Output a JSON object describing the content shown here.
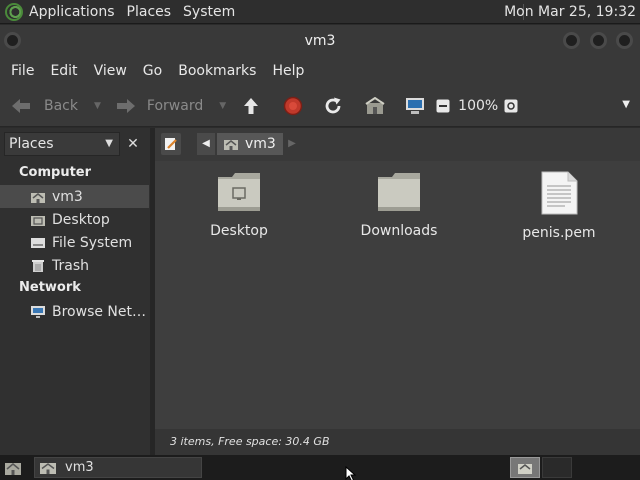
{
  "top_panel": {
    "menus": [
      "Applications",
      "Places",
      "System"
    ],
    "clock": "Mon Mar 25, 19:32"
  },
  "window": {
    "title": "vm3",
    "menubar": [
      "File",
      "Edit",
      "View",
      "Go",
      "Bookmarks",
      "Help"
    ]
  },
  "toolbar": {
    "back_label": "Back",
    "forward_label": "Forward",
    "zoom": "100%"
  },
  "sidebar": {
    "combo_label": "Places",
    "sections": [
      {
        "heading": "Computer",
        "items": [
          "vm3",
          "Desktop",
          "File System",
          "Trash"
        ]
      },
      {
        "heading": "Network",
        "items": [
          "Browse Net…"
        ]
      }
    ],
    "selected": "vm3"
  },
  "location": {
    "crumb": "vm3"
  },
  "files": [
    {
      "name": "Desktop",
      "kind": "folder-desktop"
    },
    {
      "name": "Downloads",
      "kind": "folder"
    },
    {
      "name": "penis.pem",
      "kind": "text-file"
    }
  ],
  "status": "3 items, Free space: 30.4 GB",
  "taskbar": {
    "task_label": "vm3"
  },
  "colors": {
    "panel_bg": "#2e2e2e",
    "window_bg": "#393939",
    "content_bg": "#3e3e3e",
    "selection": "#4b4b4b",
    "stop_red": "#c0392b",
    "folder": "#c9c9bf"
  }
}
